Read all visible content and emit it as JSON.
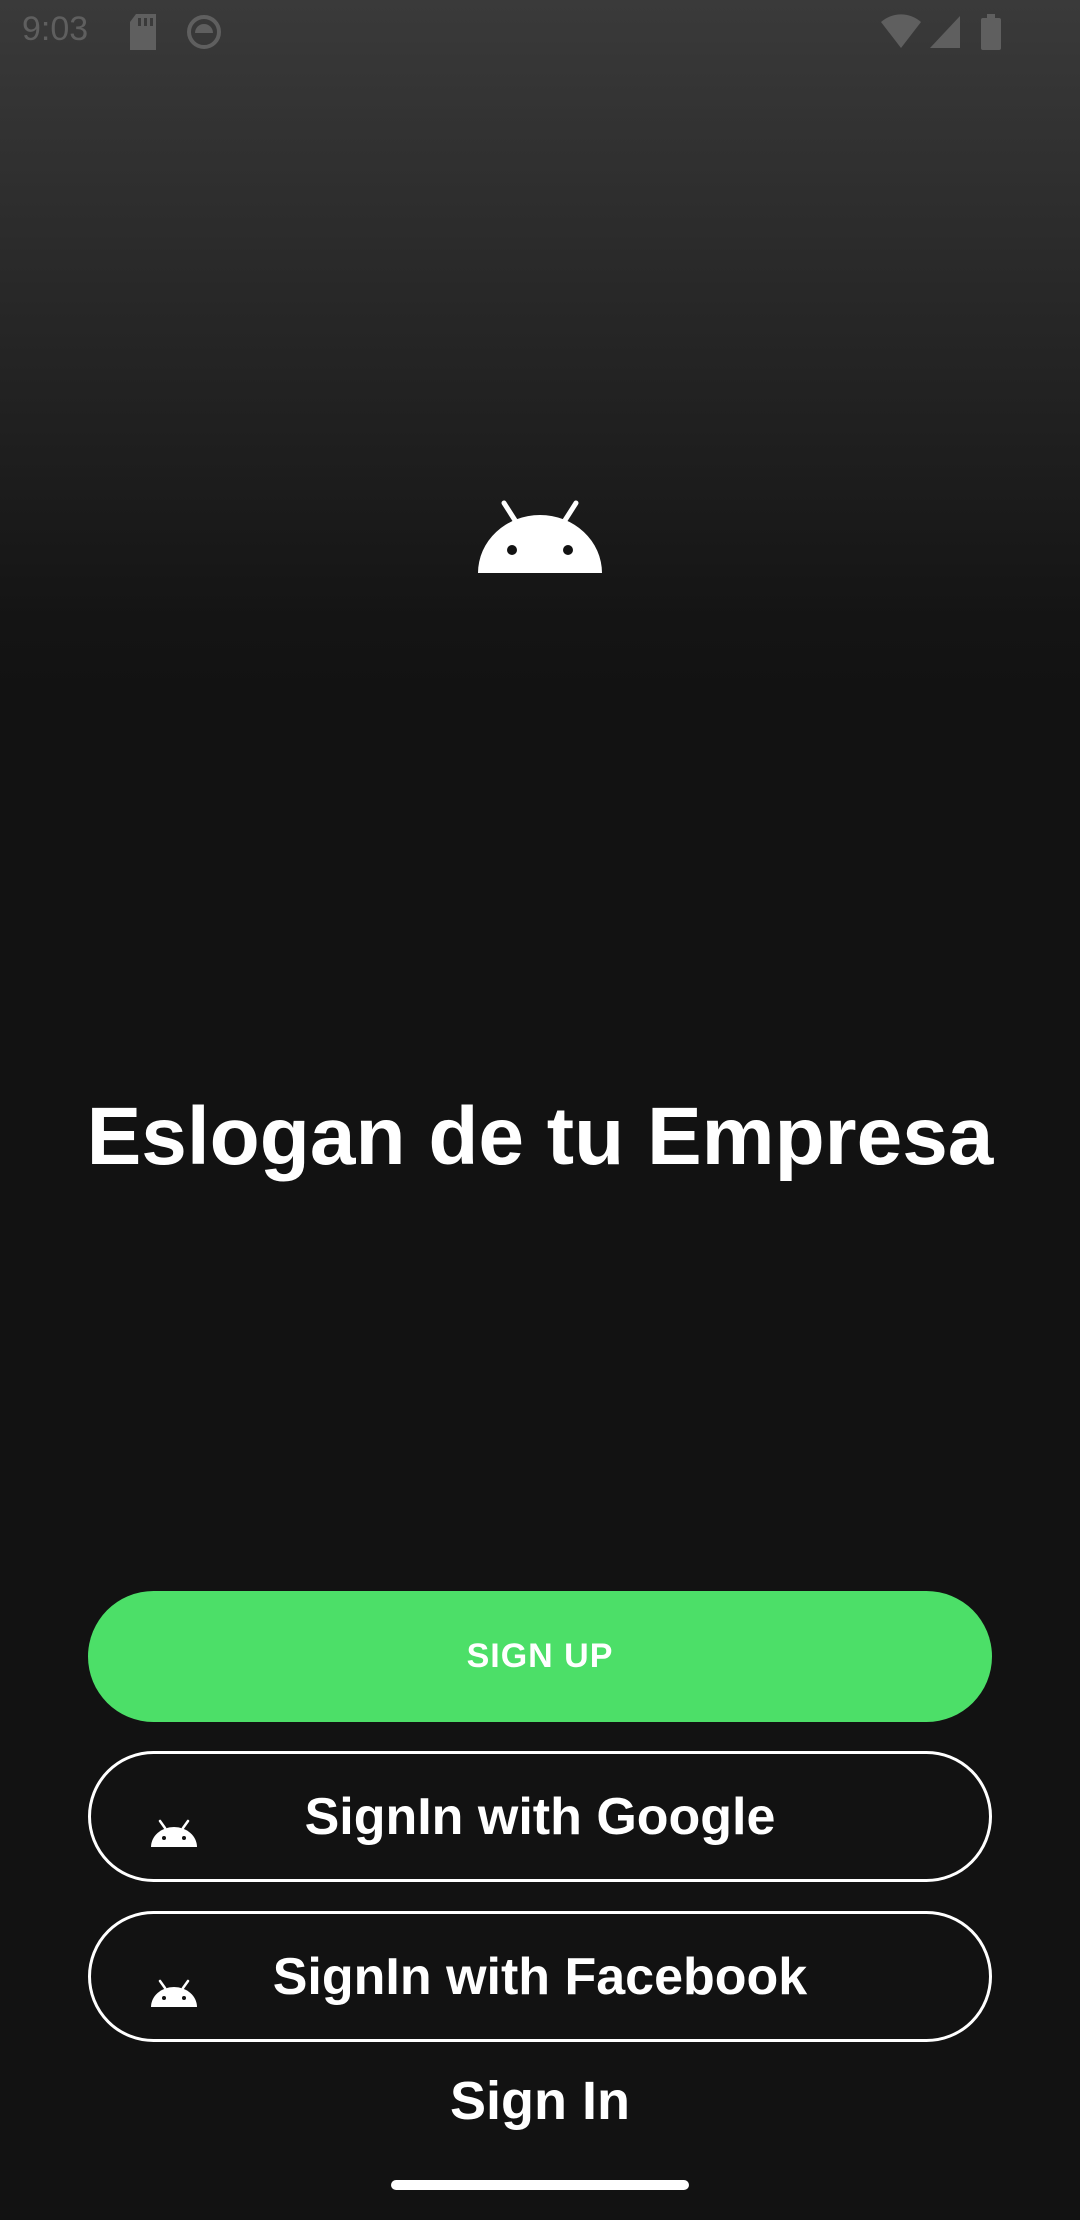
{
  "status_bar": {
    "time": "9:03",
    "icons": [
      "sd-card-icon",
      "app-notification-icon",
      "wifi-icon",
      "signal-icon",
      "battery-icon"
    ]
  },
  "logo": {
    "icon": "android-icon"
  },
  "slogan": "Eslogan de tu Empresa",
  "buttons": {
    "sign_up": "SIGN UP",
    "google": "SignIn with Google",
    "facebook": "SignIn with Facebook",
    "sign_in": "Sign In"
  },
  "colors": {
    "accent": "#4cdf68",
    "background": "#121212",
    "text": "#ffffff"
  }
}
